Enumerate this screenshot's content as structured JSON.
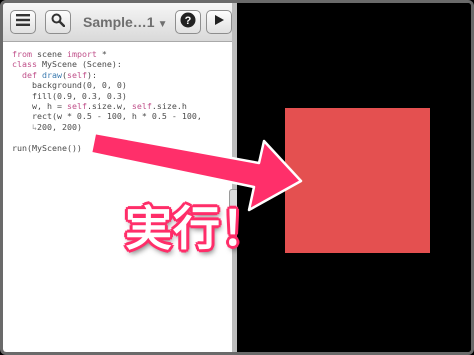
{
  "toolbar": {
    "menu_icon": "hamburger-icon",
    "search_icon": "search-icon",
    "title": "Sample…1",
    "title_caret": "▼",
    "help_icon": "help-icon",
    "run_icon": "play-icon"
  },
  "code_lines": [
    "from scene import *",
    "class MyScene (Scene):",
    "  def draw(self):",
    "    background(0, 0, 0)",
    "    fill(0.9, 0.3, 0.3)",
    "    w, h = self.size.w, self.size.h",
    "    rect(w * 0.5 - 100, h * 0.5 - 100,",
    "    ↳200, 200)",
    "",
    "run(MyScene())"
  ],
  "caption": "実行！",
  "colors": {
    "rect_fill": "#e45050",
    "arrow": "#ff2f6a",
    "keyword": "#c0508a",
    "name": "#3b7bb0"
  }
}
